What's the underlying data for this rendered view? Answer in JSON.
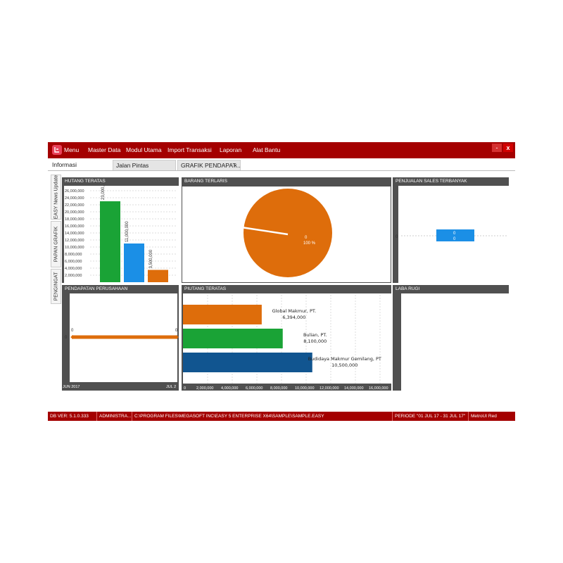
{
  "menubar": {
    "items": [
      "Menu",
      "Master Data",
      "Modul Utama",
      "Import Transaksi",
      "Laporan",
      "Alat Bantu"
    ],
    "minimize_label": "-",
    "close_label": "x"
  },
  "tabs": {
    "informasi": "Informasi",
    "jalan_pintas": "Jalan Pintas",
    "grafik": "GRAFIK PENDAPAT...",
    "grafik_close": "×"
  },
  "side_tabs": [
    "EASY News Update",
    "PAPAN GRAFIK",
    "PENGINGAT"
  ],
  "panels": {
    "hutang": {
      "title": "HUTANG TERATAS",
      "ticks": [
        "26,000,000",
        "24,000,000",
        "22,000,000",
        "20,000,000",
        "18,000,000",
        "16,000,000",
        "14,000,000",
        "12,000,000",
        "10,000,000",
        "8,000,000",
        "6,000,000",
        "4,000,000",
        "2,000,000"
      ],
      "bar_labels": [
        "23,000,000",
        "11,000,000",
        "3,500,000"
      ]
    },
    "barang": {
      "title": "BARANG TERLARIS",
      "value_label": "0",
      "pct_label": "100 %"
    },
    "sales": {
      "title": "PENJUALAN SALES TERBANYAK",
      "axis_label": "0",
      "bar_label_1": "0",
      "bar_label_2": "0"
    },
    "pendapatan": {
      "title": "PENDAPATAN PERUSAHAAN",
      "y_label": "0",
      "point_label_left": "0",
      "point_label_right": "0",
      "x_start": "JUN 2017",
      "x_end": "JUL 2"
    },
    "piutang": {
      "title": "PIUTANG TERATAS",
      "bars": [
        {
          "name": "Global Makmur, PT.",
          "value_label": "6,394,000"
        },
        {
          "name": "Bulian, PT.",
          "value_label": "8,100,000"
        },
        {
          "name": "Budidaya Makmur Gemilang, PT",
          "value_label": "10,500,000"
        }
      ],
      "x_ticks": [
        "0",
        "2,000,000",
        "4,000,000",
        "6,000,000",
        "8,000,000",
        "10,000,000",
        "12,000,000",
        "14,000,000",
        "16,000,000"
      ]
    },
    "laba": {
      "title": "LABA RUGI"
    }
  },
  "status": {
    "db_ver": "DB VER: 5.1.0.333",
    "user": "ADMINISTRA...",
    "path": "C:\\PROGRAM FILES\\MEGASOFT INC\\EASY 5 ENTERPRISE X64\\SAMPLE\\SAMPLE.EASY",
    "periode": "PERIODE \"01 JUL 17 - 31 JUL 17\"",
    "theme": "MetroUI Red"
  },
  "colors": {
    "brand": "#a40000",
    "green": "#1aa336",
    "blue": "#1b8fe6",
    "orange": "#de6d0b",
    "navy": "#115590"
  },
  "chart_data": [
    {
      "type": "bar",
      "title": "HUTANG TERATAS",
      "categories": [
        "",
        "",
        ""
      ],
      "values": [
        23000000,
        11000000,
        3500000
      ],
      "ylim": [
        0,
        26000000
      ]
    },
    {
      "type": "pie",
      "title": "BARANG TERLARIS",
      "values": [
        100
      ]
    },
    {
      "type": "bar",
      "title": "PENJUALAN SALES TERBANYAK",
      "values": [
        0
      ]
    },
    {
      "type": "line",
      "title": "PENDAPATAN PERUSAHAAN",
      "x": [
        "JUN 2017",
        "JUL 2"
      ],
      "values": [
        0,
        0
      ]
    },
    {
      "type": "bar",
      "orientation": "horizontal",
      "title": "PIUTANG TERATAS",
      "categories": [
        "Global Makmur, PT.",
        "Bulian, PT.",
        "Budidaya Makmur Gemilang, PT"
      ],
      "values": [
        6394000,
        8100000,
        10500000
      ],
      "xlim": [
        0,
        16000000
      ]
    }
  ]
}
